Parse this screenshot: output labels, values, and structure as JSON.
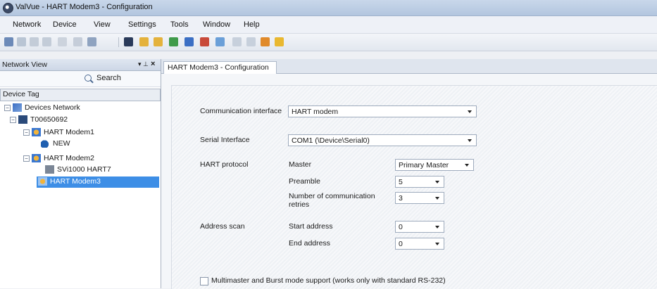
{
  "window": {
    "title": "ValVue - HART Modem3 - Configuration"
  },
  "menu": [
    "Network",
    "Device",
    "View",
    "Settings",
    "Tools",
    "Window",
    "Help"
  ],
  "toolbar": {
    "icons": [
      "connect-icon",
      "disconnect-icon",
      "open-icon",
      "save-icon",
      "cut-icon",
      "view-icon",
      "arrow-icon",
      "folder-open-icon",
      "folder-icon",
      "device-green-icon",
      "device-blue-icon",
      "device-red-icon",
      "refresh-icon",
      "grid-icon",
      "lock-icon",
      "export-icon",
      "shield-icon"
    ]
  },
  "left_pane": {
    "title": "Network View",
    "pin": "▾ ⊥",
    "close": "×",
    "search_label": "Search",
    "column_header": "Device Tag",
    "tree": [
      {
        "label": "Devices Network",
        "level": 0,
        "icon": "network-icon",
        "toggle": "−"
      },
      {
        "label": "T00650692",
        "level": 1,
        "icon": "computer-icon",
        "toggle": "−"
      },
      {
        "label": "HART Modem1",
        "level": 2,
        "icon": "modem-icon",
        "toggle": "−"
      },
      {
        "label": "NEW",
        "level": 3,
        "icon": "device-icon",
        "toggle": ""
      },
      {
        "label": "HART Modem2",
        "level": 2,
        "icon": "modem-icon",
        "toggle": "−"
      },
      {
        "label": "SVi1000 HART7",
        "level": 3,
        "icon": "positioner-icon",
        "toggle": ""
      },
      {
        "label": "HART Modem3",
        "level": 2,
        "icon": "modem-icon",
        "toggle": "",
        "selected": true
      }
    ]
  },
  "tab": {
    "label": "HART Modem3 - Configuration"
  },
  "config": {
    "communication_interface": {
      "label": "Communication interface",
      "value": "HART modem"
    },
    "serial_interface": {
      "label": "Serial Interface",
      "value": "COM1 (\\Device\\Serial0)"
    },
    "hart_protocol": {
      "label": "HART protocol",
      "master_label": "Master",
      "master_value": "Primary Master",
      "preamble_label": "Preamble",
      "preamble_value": "5",
      "retries_label_1": "Number of communication",
      "retries_label_2": "retries",
      "retries_value": "3"
    },
    "address_scan": {
      "label": "Address scan",
      "start_label": "Start address",
      "start_value": "0",
      "end_label": "End address",
      "end_value": "0"
    },
    "multimaster": {
      "label": "Multimaster and Burst mode support  (works only with standard RS-232)",
      "checked": false
    }
  },
  "colors": {
    "selection": "#3d8ee6",
    "titlebar": "#c9d7ea"
  }
}
